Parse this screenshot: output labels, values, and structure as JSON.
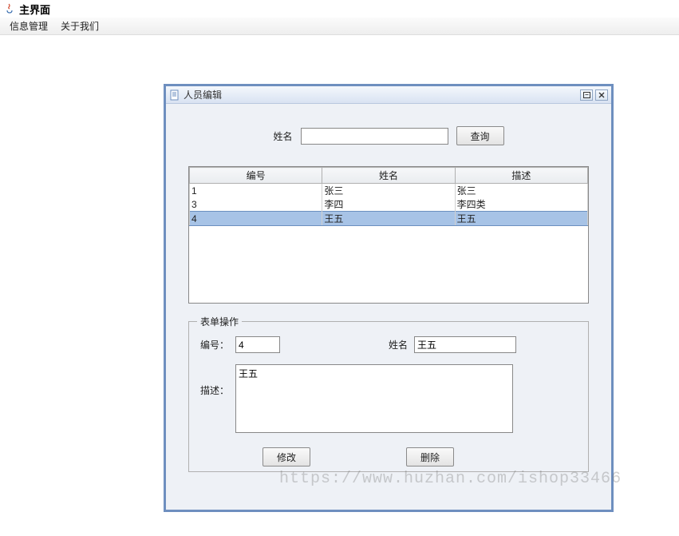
{
  "main_window": {
    "title": "主界面",
    "menubar": {
      "info_mgmt": "信息管理",
      "about": "关于我们"
    }
  },
  "dialog": {
    "title": "人员编辑",
    "search": {
      "name_label": "姓名",
      "name_value": "",
      "query_button": "查询"
    },
    "table": {
      "columns": {
        "id": "编号",
        "name": "姓名",
        "desc": "描述"
      },
      "rows": [
        {
          "id": "1",
          "name": "张三",
          "desc": "张三",
          "selected": false
        },
        {
          "id": "3",
          "name": "李四",
          "desc": "李四类",
          "selected": false
        },
        {
          "id": "4",
          "name": "王五",
          "desc": "王五",
          "selected": true
        }
      ]
    },
    "form": {
      "legend": "表单操作",
      "id_label": "编号：",
      "id_value": "4",
      "name_label": "姓名",
      "name_value": "王五",
      "desc_label": "描述：",
      "desc_value": "王五",
      "modify_button": "修改",
      "delete_button": "删除"
    }
  },
  "watermark": "https://www.huzhan.com/ishop33466"
}
